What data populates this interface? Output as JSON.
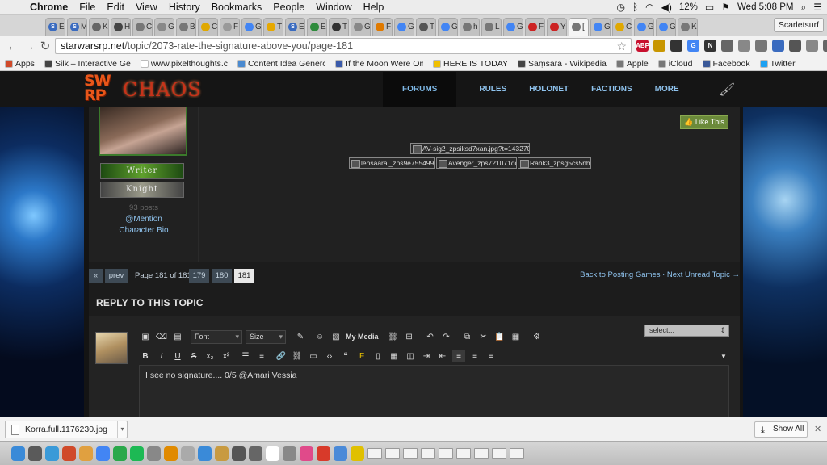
{
  "menubar": {
    "apple": "",
    "items": [
      "Chrome",
      "File",
      "Edit",
      "View",
      "History",
      "Bookmarks",
      "People",
      "Window",
      "Help"
    ],
    "battery": "12%",
    "clock": "Wed 5:08 PM"
  },
  "tabs": [
    {
      "fav": "S",
      "label": "E",
      "color": "#3a6bbf"
    },
    {
      "fav": "S",
      "label": "M",
      "color": "#3a6bbf"
    },
    {
      "fav": "",
      "label": "K",
      "color": "#666666"
    },
    {
      "fav": "",
      "label": "H",
      "color": "#444444"
    },
    {
      "fav": "",
      "label": "C",
      "color": "#777777"
    },
    {
      "fav": "",
      "label": "Go",
      "color": "#888888"
    },
    {
      "fav": "",
      "label": "B",
      "color": "#777777"
    },
    {
      "fav": "",
      "label": "C",
      "color": "#e0a800"
    },
    {
      "fav": "",
      "label": "F",
      "color": "#999999"
    },
    {
      "fav": "",
      "label": "Ge",
      "color": "#4285f4"
    },
    {
      "fav": "",
      "label": "T",
      "color": "#e6a800"
    },
    {
      "fav": "S",
      "label": "E",
      "color": "#3a6bbf"
    },
    {
      "fav": "",
      "label": "E",
      "color": "#2e8b3c"
    },
    {
      "fav": "",
      "label": "T",
      "color": "#333333"
    },
    {
      "fav": "",
      "label": "G",
      "color": "#888888"
    },
    {
      "fav": "",
      "label": "F",
      "color": "#e07a00"
    },
    {
      "fav": "",
      "label": "Gp",
      "color": "#4285f4"
    },
    {
      "fav": "",
      "label": "T",
      "color": "#555555"
    },
    {
      "fav": "",
      "label": "G",
      "color": "#4285f4"
    },
    {
      "fav": "",
      "label": "h",
      "color": "#777777"
    },
    {
      "fav": "",
      "label": "L",
      "color": "#777777"
    },
    {
      "fav": "",
      "label": "G",
      "color": "#4285f4"
    },
    {
      "fav": "",
      "label": "F",
      "color": "#cc2222"
    },
    {
      "fav": "",
      "label": "Y",
      "color": "#cc2222"
    },
    {
      "fav": "",
      "label": "[",
      "color": "#777777"
    },
    {
      "fav": "",
      "label": "Gt",
      "color": "#4285f4"
    },
    {
      "fav": "",
      "label": "C",
      "color": "#e0a800"
    },
    {
      "fav": "",
      "label": "Gi",
      "color": "#4285f4"
    },
    {
      "fav": "",
      "label": "Gk",
      "color": "#4285f4"
    },
    {
      "fav": "",
      "label": "K",
      "color": "#777777"
    }
  ],
  "profile": "Scarletsurf",
  "address": {
    "domain": "starwarsrp.net",
    "path": "/topic/2073-rate-the-signature-above-you/page-181"
  },
  "extensions": [
    {
      "label": "ABP",
      "color": "#c8102e"
    },
    {
      "label": "",
      "color": "#c89600"
    },
    {
      "label": "",
      "color": "#333333"
    },
    {
      "label": "G",
      "color": "#4285f4"
    },
    {
      "label": "N",
      "color": "#333333"
    },
    {
      "label": "",
      "color": "#666666"
    },
    {
      "label": "",
      "color": "#888888"
    },
    {
      "label": "",
      "color": "#777777"
    },
    {
      "label": "",
      "color": "#3a6bbf"
    },
    {
      "label": "",
      "color": "#555555"
    },
    {
      "label": "",
      "color": "#888888"
    },
    {
      "label": "",
      "color": "#666666"
    }
  ],
  "bookmarks": [
    {
      "label": "Apps",
      "color": "#d04a2a"
    },
    {
      "label": "Silk – Interactive Ge",
      "color": "#444444"
    },
    {
      "label": "www.pixelthoughts.c",
      "color": "#ffffff"
    },
    {
      "label": "Content Idea Generc",
      "color": "#4a8ad0"
    },
    {
      "label": "If the Moon Were On",
      "color": "#3a5aaa"
    },
    {
      "label": "HERE IS TODAY",
      "color": "#f0c000"
    },
    {
      "label": "Saṃsāra - Wikipedia",
      "color": "#444444"
    },
    {
      "label": "Apple",
      "color": "#777777"
    },
    {
      "label": "iCloud",
      "color": "#777777"
    },
    {
      "label": "Facebook",
      "color": "#3b5998"
    },
    {
      "label": "Twitter",
      "color": "#1da1f2"
    }
  ],
  "site": {
    "logo_top": "SW",
    "logo_bottom": "RP",
    "logo_word": "CHAOS",
    "nav": [
      "FORUMS",
      "RULES",
      "HOLONET",
      "FACTIONS",
      "MORE"
    ]
  },
  "post": {
    "rank1": "Writer",
    "rank2": "Knight",
    "posts": "93 posts",
    "mention": "@Mention",
    "bio": "Character Bio",
    "like": "Like This",
    "sig_main": "AV-sig2_zpsiksd7xan.jpg?t=1432703528",
    "sig_row": [
      "lensaarai_zps9e755499.png",
      "Avenger_zps721071dc.jpg",
      "Rank3_zpsg5cs5nhr.jpg"
    ]
  },
  "pager": {
    "first": "«",
    "prev": "prev",
    "info": "Page 181 of 181",
    "pages": [
      "179",
      "180",
      "181"
    ],
    "back": "Back to Posting Games · Next Unread Topic →"
  },
  "reply": {
    "title": "REPLY TO THIS TOPIC",
    "font": "Font",
    "size": "Size",
    "mymedia": "My Media",
    "select": "select...",
    "text": "I see no signature.... 0/5 @Amari Vessia"
  },
  "download": {
    "file": "Korra.full.1176230.jpg",
    "showall": "Show All"
  },
  "dock": [
    "#3a8ad8",
    "#5a5a5a",
    "#3a9ad8",
    "#d04a2a",
    "#e0a040",
    "#4285f4",
    "#2aa84a",
    "#1db954",
    "#888888",
    "#e08a00",
    "#aaaaaa",
    "#3a8ad8",
    "#c89a40",
    "#555555",
    "#666666",
    "#ffffff",
    "#888888",
    "#e04a8a",
    "#d83a2a",
    "#4a8ad8",
    "#e0c000",
    "#ffffff",
    "#888888",
    "#4285f4",
    "#555555",
    "#e04a8a",
    "#f09020",
    "#3a8ad8",
    "#888888",
    "#777777"
  ]
}
